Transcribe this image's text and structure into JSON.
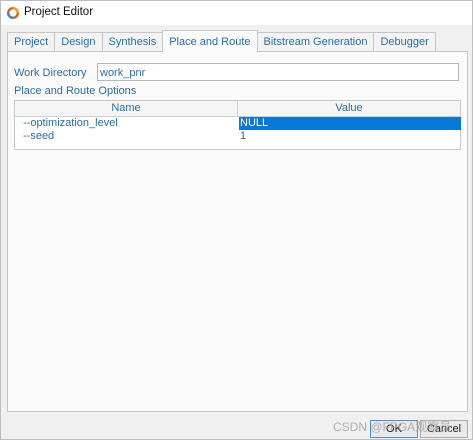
{
  "window": {
    "title": "Project Editor",
    "icon": "app-logo-icon"
  },
  "tabs": [
    {
      "label": "Project"
    },
    {
      "label": "Design"
    },
    {
      "label": "Synthesis"
    },
    {
      "label": "Place and Route",
      "active": true
    },
    {
      "label": "Bitstream Generation"
    },
    {
      "label": "Debugger"
    }
  ],
  "work_directory": {
    "label": "Work Directory",
    "value": "work_pnr"
  },
  "options": {
    "label": "Place and Route Options",
    "columns": [
      "Name",
      "Value"
    ],
    "rows": [
      {
        "name": "--optimization_level",
        "value": "NULL",
        "selected": true
      },
      {
        "name": "--seed",
        "value": "1"
      }
    ]
  },
  "buttons": {
    "ok": "OK",
    "cancel": "Cancel"
  },
  "watermark": "CSDN @FPGA观察员",
  "colors": {
    "text_blue": "#2a6ea6",
    "selection": "#0a78d7"
  }
}
